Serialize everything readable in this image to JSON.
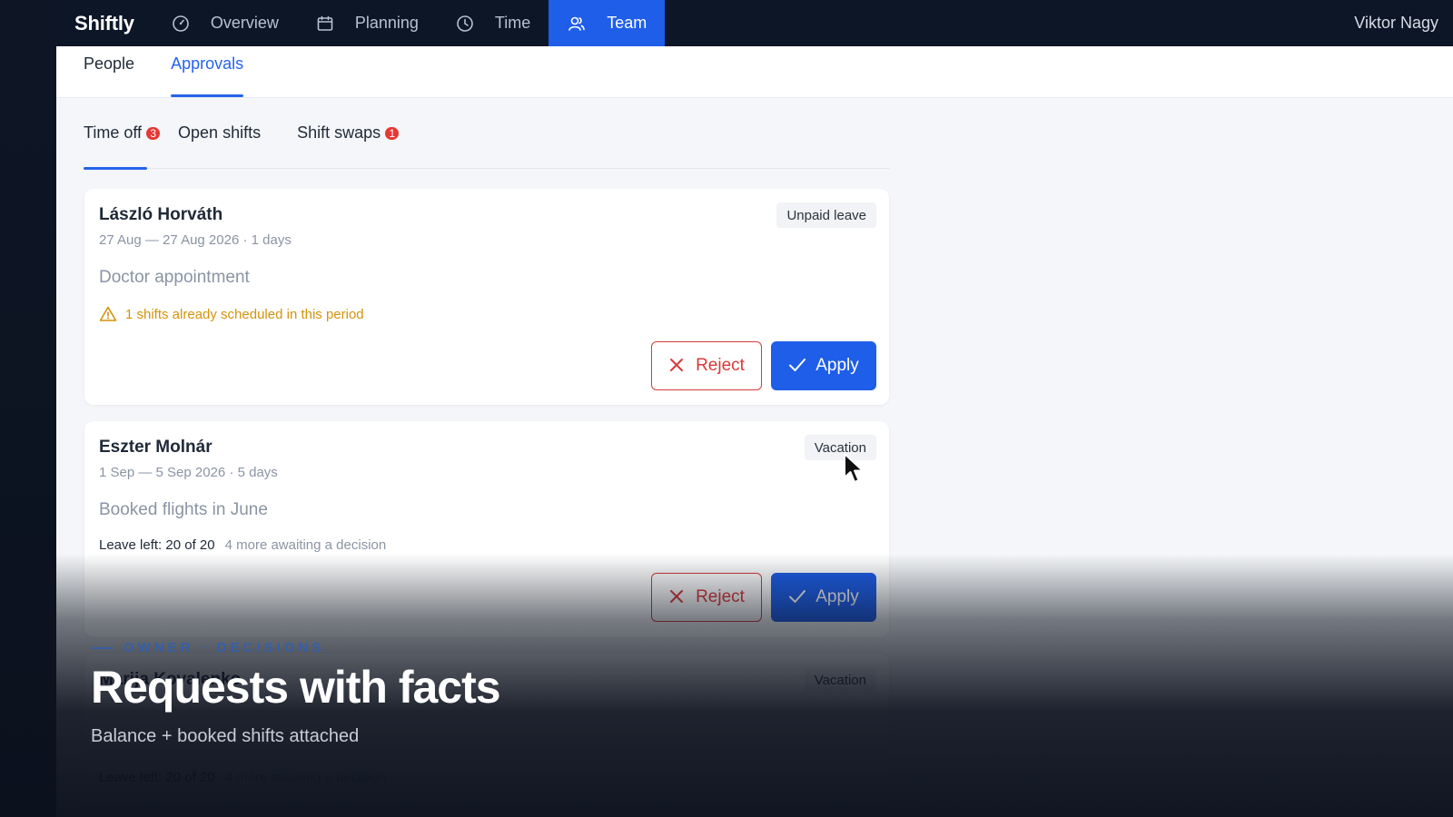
{
  "app": {
    "brand": "Shiftly",
    "user": "Viktor Nagy"
  },
  "topnav": {
    "items": [
      {
        "label": "Overview",
        "icon": "gauge-icon"
      },
      {
        "label": "Planning",
        "icon": "calendar-icon"
      },
      {
        "label": "Time",
        "icon": "clock-icon"
      },
      {
        "label": "Team",
        "icon": "team-icon",
        "active": true
      }
    ]
  },
  "subnav": {
    "items": [
      {
        "label": "People"
      },
      {
        "label": "Approvals",
        "active": true
      }
    ]
  },
  "tabs": {
    "items": [
      {
        "label": "Time off",
        "badge": "3",
        "active": true
      },
      {
        "label": "Open shifts"
      },
      {
        "label": "Shift swaps",
        "badge": "1"
      }
    ]
  },
  "requests": [
    {
      "name": "László Horváth",
      "dates": "27 Aug — 27 Aug 2026 · 1 days",
      "type": "Unpaid leave",
      "reason": "Doctor appointment",
      "warning": "1 shifts already scheduled in this period",
      "reject_label": "Reject",
      "apply_label": "Apply"
    },
    {
      "name": "Eszter Molnár",
      "dates": "1 Sep — 5 Sep 2026 · 5 days",
      "type": "Vacation",
      "reason": "Booked flights in June",
      "balance": "Leave left: 20 of 20",
      "awaiting": "4 more awaiting a decision",
      "reject_label": "Reject",
      "apply_label": "Apply"
    },
    {
      "name": "Marija Kovalenko",
      "type": "Vacation",
      "balance": "Leave left: 20 of 20",
      "awaiting": "4 more awaiting a decision"
    }
  ],
  "overlay": {
    "kicker": "OWNER · DECISIONS",
    "headline": "Requests with facts",
    "subtitle": "Balance + booked shifts attached"
  },
  "colors": {
    "accent": "#1e5ee8",
    "danger": "#d83a3a",
    "warning": "#d4930c",
    "nav_bg": "#0d1627"
  }
}
